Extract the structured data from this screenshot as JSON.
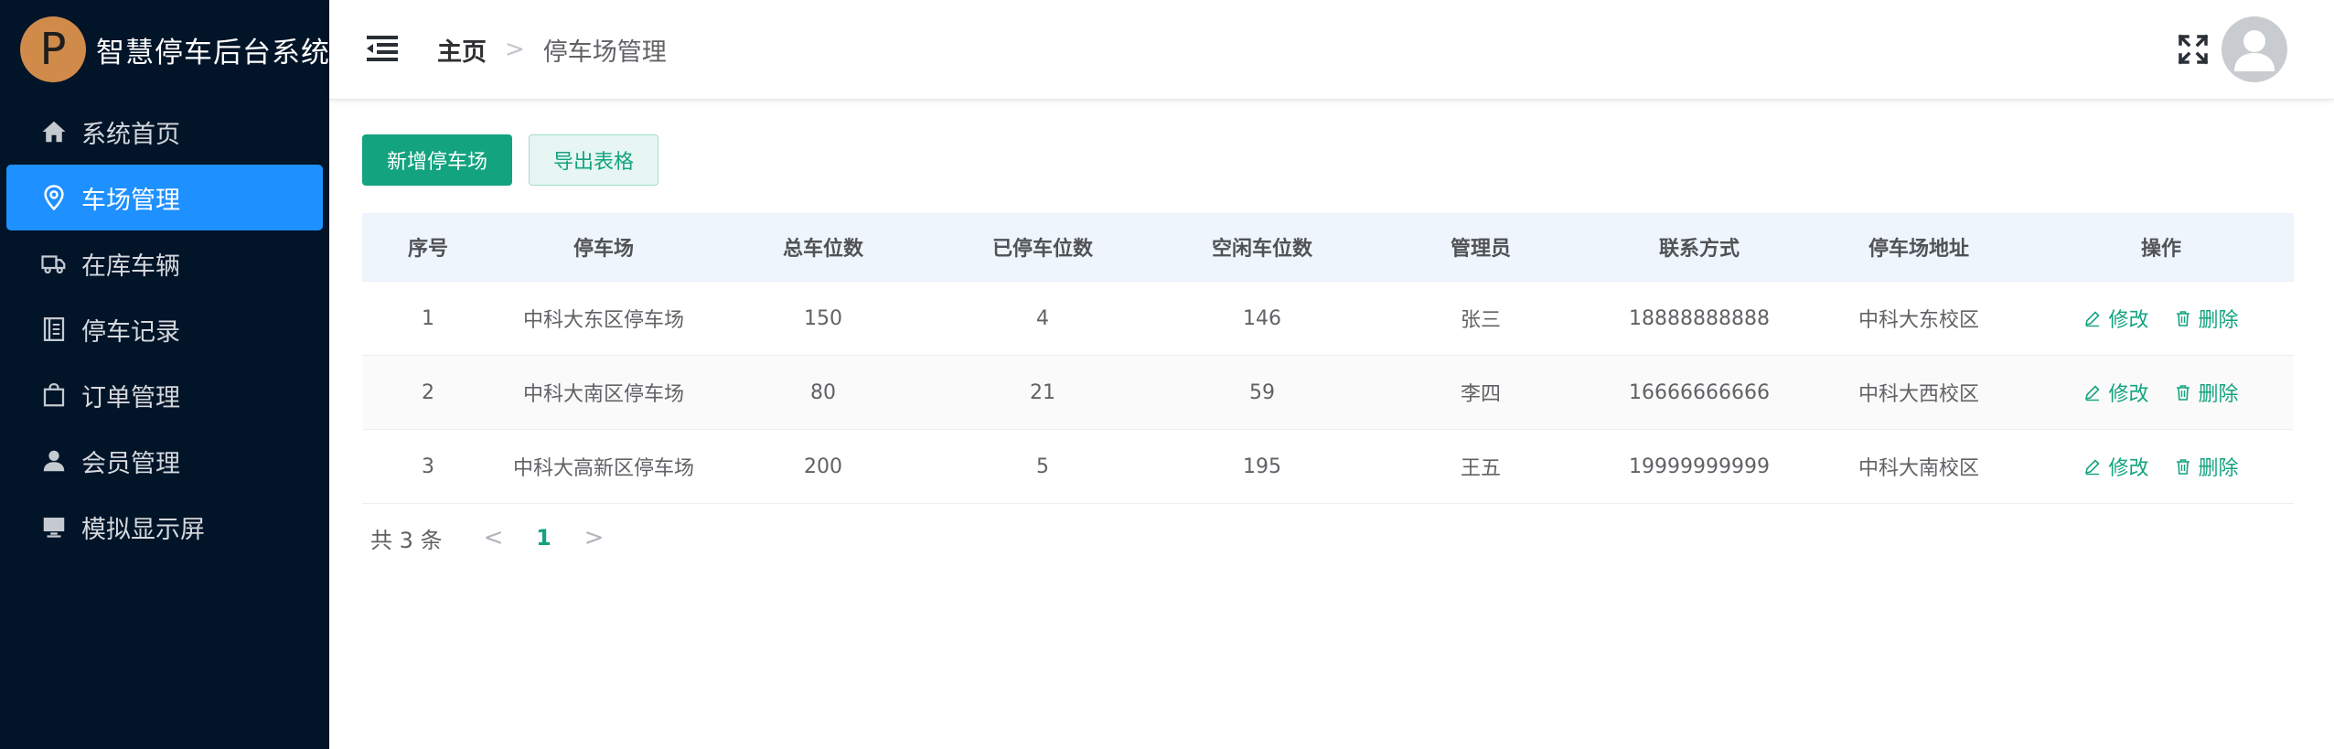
{
  "app": {
    "logo_letter": "P",
    "title": "智慧停车后台系统"
  },
  "sidebar": {
    "items": [
      {
        "label": "系统首页",
        "icon": "home-icon",
        "active": false
      },
      {
        "label": "车场管理",
        "icon": "location-pin-icon",
        "active": true
      },
      {
        "label": "在库车辆",
        "icon": "truck-icon",
        "active": false
      },
      {
        "label": "停车记录",
        "icon": "notebook-icon",
        "active": false
      },
      {
        "label": "订单管理",
        "icon": "shopping-bag-icon",
        "active": false
      },
      {
        "label": "会员管理",
        "icon": "user-icon",
        "active": false
      },
      {
        "label": "模拟显示屏",
        "icon": "monitor-icon",
        "active": false
      }
    ]
  },
  "header": {
    "breadcrumb": {
      "home": "主页",
      "separator": ">",
      "current": "停车场管理"
    }
  },
  "toolbar": {
    "add_label": "新增停车场",
    "export_label": "导出表格"
  },
  "table": {
    "columns": [
      "序号",
      "停车场",
      "总车位数",
      "已停车位数",
      "空闲车位数",
      "管理员",
      "联系方式",
      "停车场地址",
      "操作"
    ],
    "rows": [
      [
        "1",
        "中科大东区停车场",
        "150",
        "4",
        "146",
        "张三",
        "18888888888",
        "中科大东校区"
      ],
      [
        "2",
        "中科大南区停车场",
        "80",
        "21",
        "59",
        "李四",
        "16666666666",
        "中科大西校区"
      ],
      [
        "3",
        "中科大高新区停车场",
        "200",
        "5",
        "195",
        "王五",
        "19999999999",
        "中科大南校区"
      ]
    ],
    "actions": {
      "edit": "修改",
      "delete": "删除"
    }
  },
  "pagination": {
    "total": "共 3 条",
    "current_page": "1",
    "prev": "<",
    "next": ">"
  },
  "colors": {
    "sidebar_bg": "#011428",
    "active": "#1e90ff",
    "accent": "#13a37f",
    "logo": "#d08a4a"
  }
}
